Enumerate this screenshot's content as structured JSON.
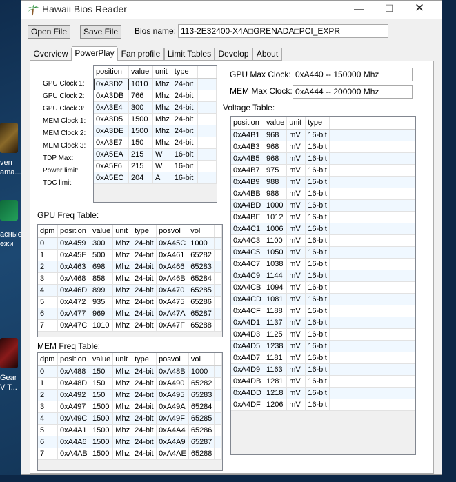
{
  "desktop": {
    "labels": [
      "ven",
      "ama...",
      "асные",
      "ежи",
      "Gear",
      "V T..."
    ]
  },
  "window": {
    "title": "Hawaii Bios Reader",
    "minimize": "—",
    "maximize": "☐",
    "close": "✕"
  },
  "toolbar": {
    "open_file": "Open File",
    "save_file": "Save File",
    "bios_name_label": "Bios name:",
    "bios_name_value": "113-2E32400-X4A□GRENADA□PCI_EXPR"
  },
  "tabs": [
    "Overview",
    "PowerPlay",
    "Fan profile",
    "Limit Tables",
    "Develop",
    "About"
  ],
  "active_tab": "PowerPlay",
  "powerplay": {
    "param_labels": [
      "GPU Clock 1:",
      "GPU Clock 2:",
      "GPU Clock 3:",
      "MEM Clock 1:",
      "MEM Clock 2:",
      "MEM Clock 3:",
      "TDP Max:",
      "Power limit:",
      "TDC limit:"
    ],
    "param_headers": [
      "position",
      "value",
      "unit",
      "type"
    ],
    "param_rows": [
      [
        "0xA3D2",
        "1010",
        "Mhz",
        "24-bit"
      ],
      [
        "0xA3DB",
        "766",
        "Mhz",
        "24-bit"
      ],
      [
        "0xA3E4",
        "300",
        "Mhz",
        "24-bit"
      ],
      [
        "0xA3D5",
        "1500",
        "Mhz",
        "24-bit"
      ],
      [
        "0xA3DE",
        "1500",
        "Mhz",
        "24-bit"
      ],
      [
        "0xA3E7",
        "150",
        "Mhz",
        "24-bit"
      ],
      [
        "0xA5EA",
        "215",
        "W",
        "16-bit"
      ],
      [
        "0xA5F6",
        "215",
        "W",
        "16-bit"
      ],
      [
        "0xA5EC",
        "204",
        "A",
        "16-bit"
      ]
    ],
    "gpu_max_clock_label": "GPU Max Clock:",
    "gpu_max_clock_value": "0xA440 -- 150000 Mhz",
    "mem_max_clock_label": "MEM Max Clock:",
    "mem_max_clock_value": "0xA444 -- 200000 Mhz",
    "voltage_table_label": "Voltage Table:",
    "voltage_headers": [
      "position",
      "value",
      "unit",
      "type"
    ],
    "voltage_rows": [
      [
        "0xA4B1",
        "968",
        "mV",
        "16-bit"
      ],
      [
        "0xA4B3",
        "968",
        "mV",
        "16-bit"
      ],
      [
        "0xA4B5",
        "968",
        "mV",
        "16-bit"
      ],
      [
        "0xA4B7",
        "975",
        "mV",
        "16-bit"
      ],
      [
        "0xA4B9",
        "988",
        "mV",
        "16-bit"
      ],
      [
        "0xA4BB",
        "988",
        "mV",
        "16-bit"
      ],
      [
        "0xA4BD",
        "1000",
        "mV",
        "16-bit"
      ],
      [
        "0xA4BF",
        "1012",
        "mV",
        "16-bit"
      ],
      [
        "0xA4C1",
        "1006",
        "mV",
        "16-bit"
      ],
      [
        "0xA4C3",
        "1100",
        "mV",
        "16-bit"
      ],
      [
        "0xA4C5",
        "1050",
        "mV",
        "16-bit"
      ],
      [
        "0xA4C7",
        "1038",
        "mV",
        "16-bit"
      ],
      [
        "0xA4C9",
        "1144",
        "mV",
        "16-bit"
      ],
      [
        "0xA4CB",
        "1094",
        "mV",
        "16-bit"
      ],
      [
        "0xA4CD",
        "1081",
        "mV",
        "16-bit"
      ],
      [
        "0xA4CF",
        "1188",
        "mV",
        "16-bit"
      ],
      [
        "0xA4D1",
        "1137",
        "mV",
        "16-bit"
      ],
      [
        "0xA4D3",
        "1125",
        "mV",
        "16-bit"
      ],
      [
        "0xA4D5",
        "1238",
        "mV",
        "16-bit"
      ],
      [
        "0xA4D7",
        "1181",
        "mV",
        "16-bit"
      ],
      [
        "0xA4D9",
        "1163",
        "mV",
        "16-bit"
      ],
      [
        "0xA4DB",
        "1281",
        "mV",
        "16-bit"
      ],
      [
        "0xA4DD",
        "1218",
        "mV",
        "16-bit"
      ],
      [
        "0xA4DF",
        "1206",
        "mV",
        "16-bit"
      ]
    ],
    "gpu_freq_label": "GPU Freq Table:",
    "freq_headers": [
      "dpm",
      "position",
      "value",
      "unit",
      "type",
      "posvol",
      "vol"
    ],
    "gpu_freq_rows": [
      [
        "0",
        "0xA459",
        "300",
        "Mhz",
        "24-bit",
        "0xA45C",
        "1000"
      ],
      [
        "1",
        "0xA45E",
        "500",
        "Mhz",
        "24-bit",
        "0xA461",
        "65282"
      ],
      [
        "2",
        "0xA463",
        "698",
        "Mhz",
        "24-bit",
        "0xA466",
        "65283"
      ],
      [
        "3",
        "0xA468",
        "858",
        "Mhz",
        "24-bit",
        "0xA46B",
        "65284"
      ],
      [
        "4",
        "0xA46D",
        "899",
        "Mhz",
        "24-bit",
        "0xA470",
        "65285"
      ],
      [
        "5",
        "0xA472",
        "935",
        "Mhz",
        "24-bit",
        "0xA475",
        "65286"
      ],
      [
        "6",
        "0xA477",
        "969",
        "Mhz",
        "24-bit",
        "0xA47A",
        "65287"
      ],
      [
        "7",
        "0xA47C",
        "1010",
        "Mhz",
        "24-bit",
        "0xA47F",
        "65288"
      ]
    ],
    "mem_freq_label": "MEM Freq Table:",
    "mem_freq_rows": [
      [
        "0",
        "0xA488",
        "150",
        "Mhz",
        "24-bit",
        "0xA48B",
        "1000"
      ],
      [
        "1",
        "0xA48D",
        "150",
        "Mhz",
        "24-bit",
        "0xA490",
        "65282"
      ],
      [
        "2",
        "0xA492",
        "150",
        "Mhz",
        "24-bit",
        "0xA495",
        "65283"
      ],
      [
        "3",
        "0xA497",
        "1500",
        "Mhz",
        "24-bit",
        "0xA49A",
        "65284"
      ],
      [
        "4",
        "0xA49C",
        "1500",
        "Mhz",
        "24-bit",
        "0xA49F",
        "65285"
      ],
      [
        "5",
        "0xA4A1",
        "1500",
        "Mhz",
        "24-bit",
        "0xA4A4",
        "65286"
      ],
      [
        "6",
        "0xA4A6",
        "1500",
        "Mhz",
        "24-bit",
        "0xA4A9",
        "65287"
      ],
      [
        "7",
        "0xA4AB",
        "1500",
        "Mhz",
        "24-bit",
        "0xA4AE",
        "65288"
      ]
    ]
  }
}
